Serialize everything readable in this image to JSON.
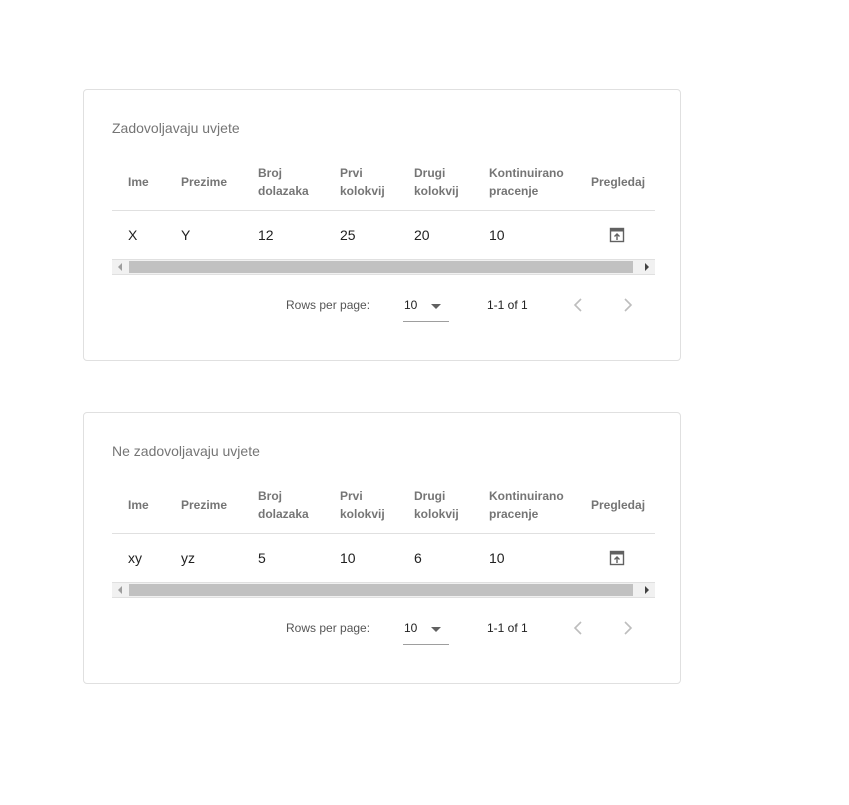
{
  "columns": [
    "Ime",
    "Prezime",
    "Broj dolazaka",
    "Prvi kolokvij",
    "Drugi kolokvij",
    "Kontinuirano pracenje",
    "Pregledaj"
  ],
  "tables": [
    {
      "title": "Zadovoljavaju uvjete",
      "rows": [
        {
          "ime": "X",
          "prezime": "Y",
          "broj_dolazaka": "12",
          "prvi_kolokvij": "25",
          "drugi_kolokvij": "20",
          "kontinuirano": "10"
        }
      ],
      "pagination": {
        "rows_per_page_label": "Rows per page:",
        "rows_per_page": "10",
        "range": "1-1 of 1"
      }
    },
    {
      "title": "Ne zadovoljavaju uvjete",
      "rows": [
        {
          "ime": "xy",
          "prezime": "yz",
          "broj_dolazaka": "5",
          "prvi_kolokvij": "10",
          "drugi_kolokvij": "6",
          "kontinuirano": "10"
        }
      ],
      "pagination": {
        "rows_per_page_label": "Rows per page:",
        "rows_per_page": "10",
        "range": "1-1 of 1"
      }
    }
  ],
  "icons": {
    "view": "open-in-browser-icon",
    "prev": "chevron-left-icon",
    "next": "chevron-right-icon"
  },
  "colors": {
    "border": "#e0e0e0",
    "muted_text": "#757575",
    "scroll_thumb": "#c1c1c1"
  }
}
